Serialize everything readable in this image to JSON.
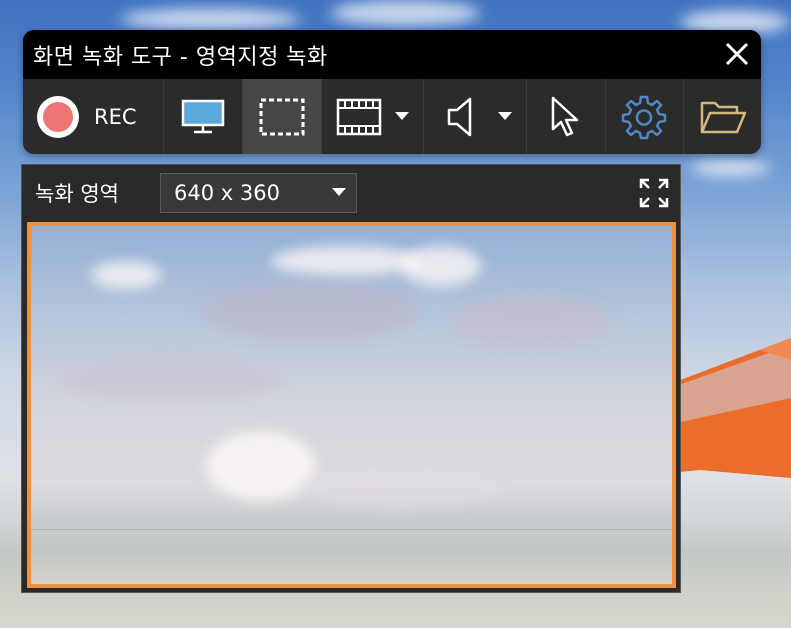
{
  "window": {
    "title": "화면 녹화 도구 - 영역지정 녹화"
  },
  "toolbar": {
    "rec_label": "REC",
    "buttons": [
      {
        "name": "record-button",
        "icon": "record-icon"
      },
      {
        "name": "fullscreen-mode-button",
        "icon": "monitor-icon"
      },
      {
        "name": "region-mode-button",
        "icon": "dashed-rect-icon",
        "active": true
      },
      {
        "name": "video-format-button",
        "icon": "film-icon"
      },
      {
        "name": "audio-button",
        "icon": "speaker-icon"
      },
      {
        "name": "cursor-button",
        "icon": "cursor-icon"
      },
      {
        "name": "settings-button",
        "icon": "gear-icon"
      },
      {
        "name": "open-folder-button",
        "icon": "folder-icon"
      }
    ]
  },
  "capture": {
    "area_label": "녹화 영역",
    "size_value": "640 x 360"
  },
  "colors": {
    "rec_red": "#ef7474",
    "monitor_blue": "#5aa8dc",
    "gear_blue": "#4f86c4",
    "folder_gold": "#d6b97a",
    "frame_orange": "#f0913b",
    "umbrella_orange": "#ec6c2c"
  }
}
